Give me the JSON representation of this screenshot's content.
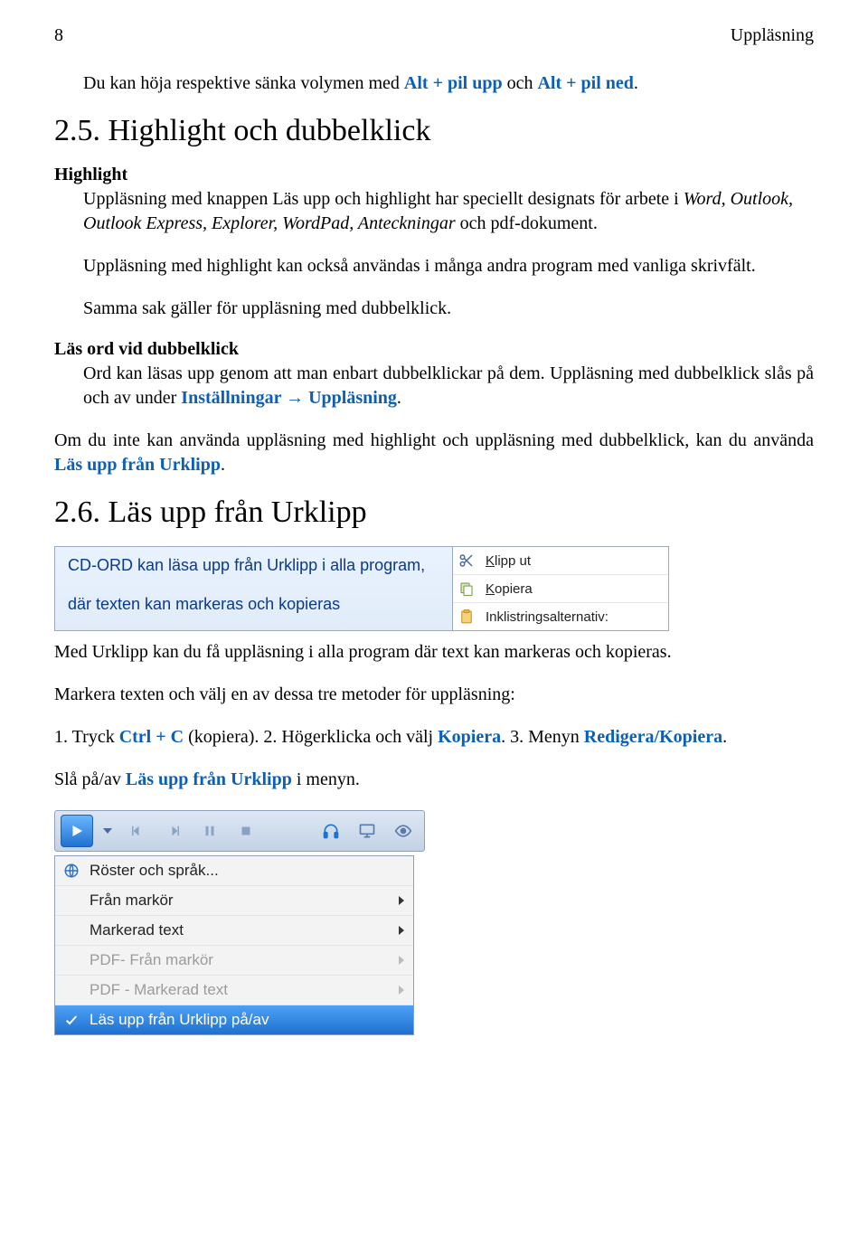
{
  "header": {
    "page_number": "8",
    "section": "Uppläsning"
  },
  "p1": {
    "pre": "Du kan höja respektive sänka volymen med ",
    "k1": "Alt + pil upp",
    "mid": " och ",
    "k2": "Alt + pil ned",
    "post": "."
  },
  "sec25": {
    "title": "2.5. Highlight och dubbelklick",
    "h_highlight": "Highlight",
    "p2a": "Uppläsning med knappen Läs upp och highlight har speciellt designats för arbete i ",
    "p2apps": "Word, Outlook, Outlook Express, Explorer, WordPad, Anteckningar",
    "p2b": " och pdf-dokument.",
    "p3": "Uppläsning med highlight kan också användas i många andra program med vanliga skrivfält.",
    "p4": "Samma sak gäller för uppläsning med dubbelklick.",
    "h_doubleclick": "Läs ord vid dubbelklick",
    "p5a": "Ord kan läsas upp genom att man enbart dubbelklickar på dem. Uppläsning med dubbelklick slås på och av under ",
    "p5link": "Inställningar → Uppläsning",
    "p5b": ".",
    "p6a": "Om du inte kan använda uppläsning med highlight och uppläsning med dubbelklick, kan du använda ",
    "p6link": "Läs upp från Urklipp",
    "p6b": "."
  },
  "sec26": {
    "title": "2.6. Läs upp från Urklipp",
    "editor": {
      "line1": "CD-ORD kan läsa upp från Urklipp i alla program,",
      "line2": "där texten kan markeras och kopieras"
    },
    "context_menu": {
      "items": [
        {
          "icon": "scissors",
          "label_html": "Klipp ut",
          "underline_index": 0
        },
        {
          "icon": "copy",
          "label_html": "Kopiera",
          "underline_index": 0
        },
        {
          "icon": "paste",
          "label_html": "Inklistringsalternativ:",
          "underline_index": -1
        }
      ]
    },
    "p7": "Med Urklipp kan du få uppläsning i alla program där text kan markeras och kopieras.",
    "p8": "Markera texten och välj en av dessa tre metoder för uppläsning:",
    "steps": {
      "s1a": "1. Tryck ",
      "s1k": "Ctrl + C",
      "s1b": " (kopiera). 2. Högerklicka och välj ",
      "s2k": "Kopiera",
      "s2b": ". 3. Menyn ",
      "s3k": "Redigera/Kopiera",
      "s3b": "."
    },
    "p9a": "Slå på/av ",
    "p9link": "Läs upp från Urklipp",
    "p9b": " i menyn.",
    "menu": {
      "voices": "Röster och språk...",
      "from_marker": "Från markör",
      "marked_text": "Markerad text",
      "pdf_from_marker": "PDF- Från markör",
      "pdf_marked_text": "PDF - Markerad text",
      "toggle": "Läs upp från Urklipp på/av"
    }
  }
}
